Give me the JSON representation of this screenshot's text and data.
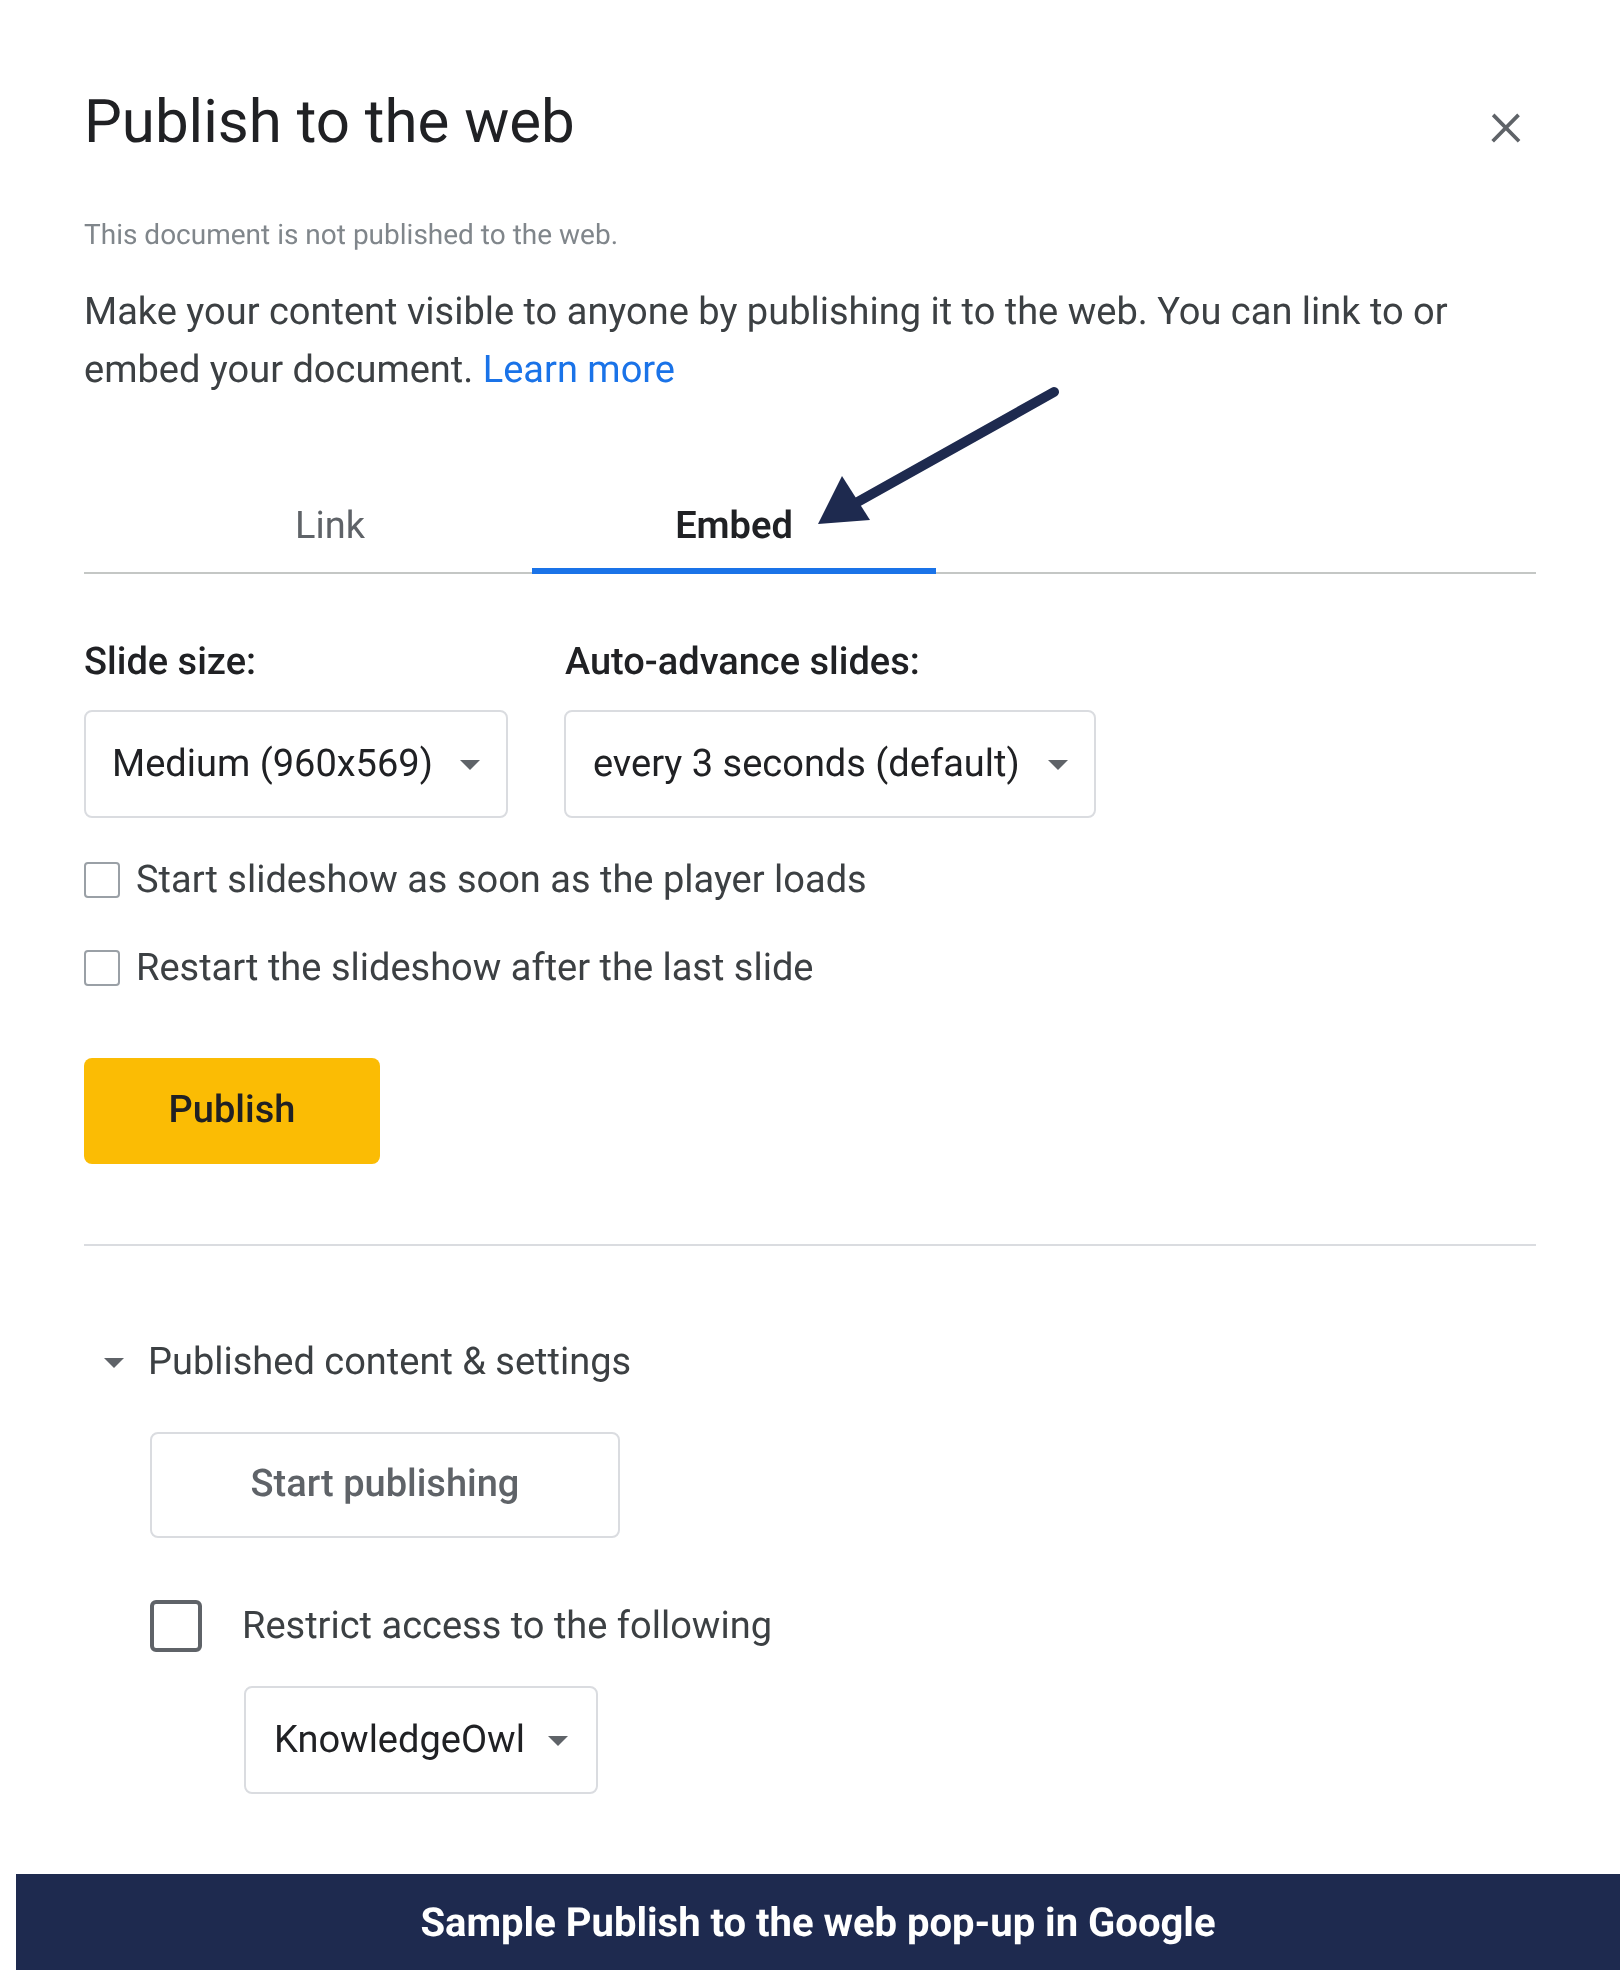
{
  "dialog": {
    "title": "Publish to the web",
    "close": "×"
  },
  "status": "This document is not published to the web.",
  "description": {
    "text": "Make your content visible to anyone by publishing it to the web. You can link to or embed your document.",
    "link": "Learn more"
  },
  "tabs": [
    {
      "label": "Link",
      "selected": false
    },
    {
      "label": "Embed",
      "selected": true
    }
  ],
  "selects": [
    {
      "label": "Slide size:",
      "value": "Medium (960x569)"
    },
    {
      "label": "Auto-advance slides:",
      "value": "every 3 seconds (default)"
    }
  ],
  "options": [
    {
      "label": "Start slideshow as soon as the player loads",
      "checked": false
    },
    {
      "label": "Restart the slideshow after the last slide",
      "checked": false
    }
  ],
  "publish_button": "Publish",
  "published_section": {
    "title": "Published content & settings",
    "expanded": true,
    "start_button": "Start publishing",
    "restrict": {
      "label": "Restrict access to the following",
      "checked": false
    },
    "domain": "KnowledgeOwl"
  },
  "caption": "Sample Publish to the web pop-up in Google"
}
